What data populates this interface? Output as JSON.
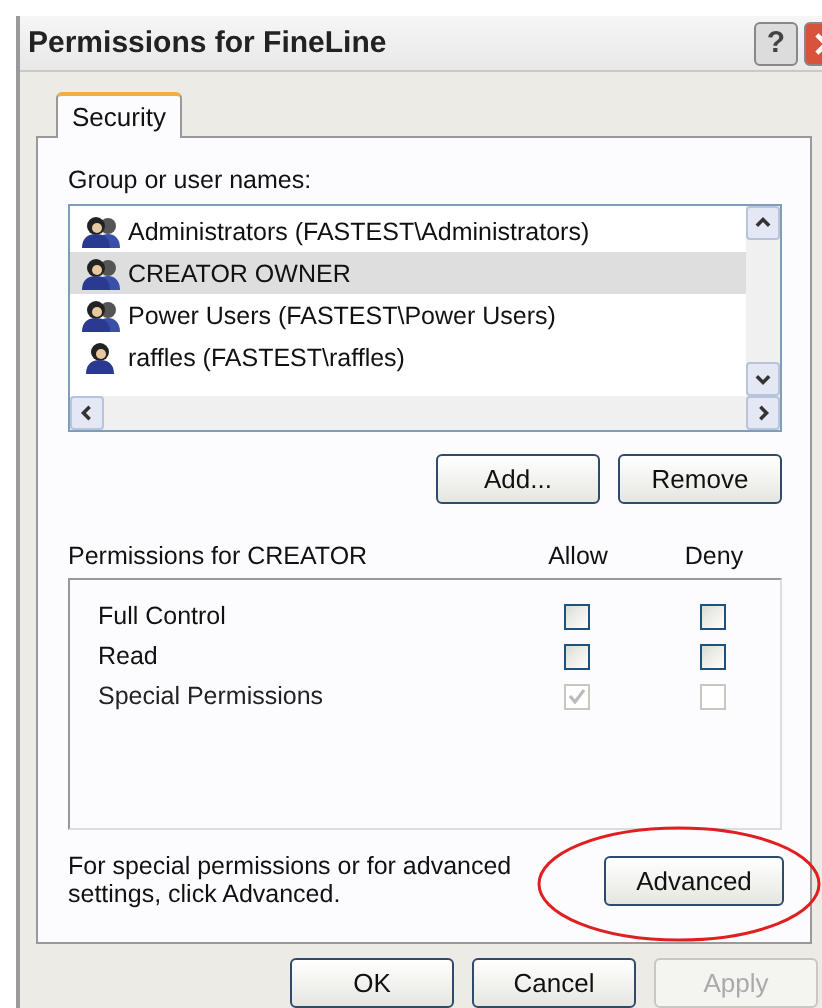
{
  "window": {
    "title": "Permissions for FineLine",
    "help": "?"
  },
  "tabs": [
    {
      "label": "Security",
      "selected": true
    }
  ],
  "group_list": {
    "label": "Group or user names:",
    "items": [
      {
        "name": "Administrators (FASTEST\\Administrators)",
        "kind": "group",
        "selected": false
      },
      {
        "name": "CREATOR OWNER",
        "kind": "group",
        "selected": true
      },
      {
        "name": "Power Users (FASTEST\\Power Users)",
        "kind": "group",
        "selected": false
      },
      {
        "name": "raffles (FASTEST\\raffles)",
        "kind": "user",
        "selected": false
      }
    ]
  },
  "list_buttons": [
    "Add...",
    "Remove"
  ],
  "permissions": {
    "label": "Permissions for CREATOR",
    "columns": [
      "Allow",
      "Deny"
    ],
    "rows": [
      {
        "name": "Full Control",
        "allow": false,
        "deny": false,
        "disabled": false
      },
      {
        "name": "Read",
        "allow": false,
        "deny": false,
        "disabled": false
      },
      {
        "name": "Special Permissions",
        "allow": true,
        "deny": false,
        "disabled": true
      }
    ]
  },
  "advanced": {
    "text": "For special permissions or for advanced settings, click Advanced.",
    "button": "Advanced"
  },
  "buttons": [
    {
      "label": "OK",
      "disabled": false
    },
    {
      "label": "Cancel",
      "disabled": false
    },
    {
      "label": "Apply",
      "disabled": true
    }
  ]
}
